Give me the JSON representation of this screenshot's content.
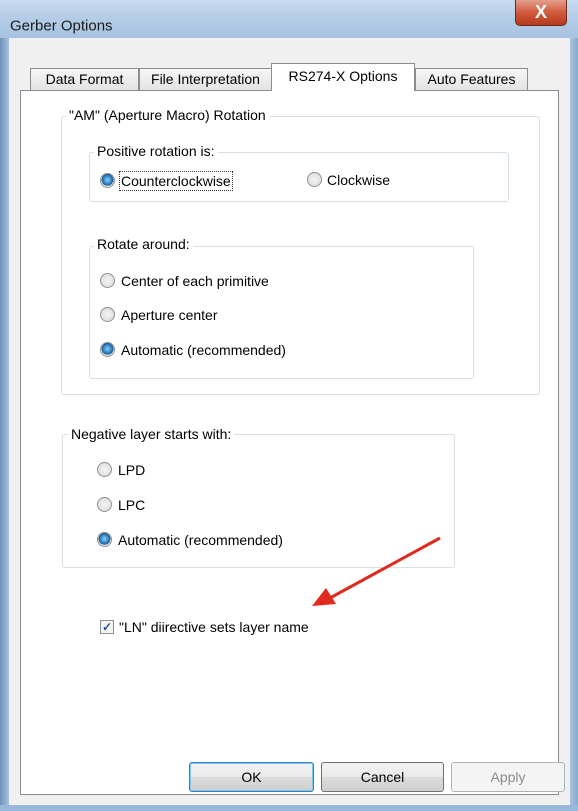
{
  "window": {
    "title": "Gerber Options",
    "close_glyph": "X"
  },
  "tabs": [
    {
      "label": "Data Format"
    },
    {
      "label": "File Interpretation"
    },
    {
      "label": "RS274-X Options"
    },
    {
      "label": "Auto Features"
    }
  ],
  "am_group": {
    "legend": "\"AM\" (Aperture Macro) Rotation",
    "positive": {
      "legend": "Positive rotation is:",
      "options": [
        {
          "label": "Counterclockwise",
          "checked": true
        },
        {
          "label": "Clockwise",
          "checked": false
        }
      ]
    },
    "rotate_around": {
      "legend": "Rotate around:",
      "options": [
        {
          "label": "Center of each primitive",
          "checked": false
        },
        {
          "label": "Aperture center",
          "checked": false
        },
        {
          "label": "Automatic (recommended)",
          "checked": true
        }
      ]
    }
  },
  "negative_group": {
    "legend": "Negative layer starts with:",
    "options": [
      {
        "label": "LPD",
        "checked": false
      },
      {
        "label": "LPC",
        "checked": false
      },
      {
        "label": "Automatic (recommended)",
        "checked": true
      }
    ]
  },
  "ln_checkbox": {
    "label": "\"LN\" diirective sets layer name",
    "checked": true
  },
  "buttons": {
    "ok": "OK",
    "cancel": "Cancel",
    "apply": "Apply"
  },
  "colors": {
    "accent": "#1e5a9c",
    "annotation_arrow": "#e02a1f",
    "title_bar": "#b5cde7",
    "close_button": "#c94a2b"
  }
}
